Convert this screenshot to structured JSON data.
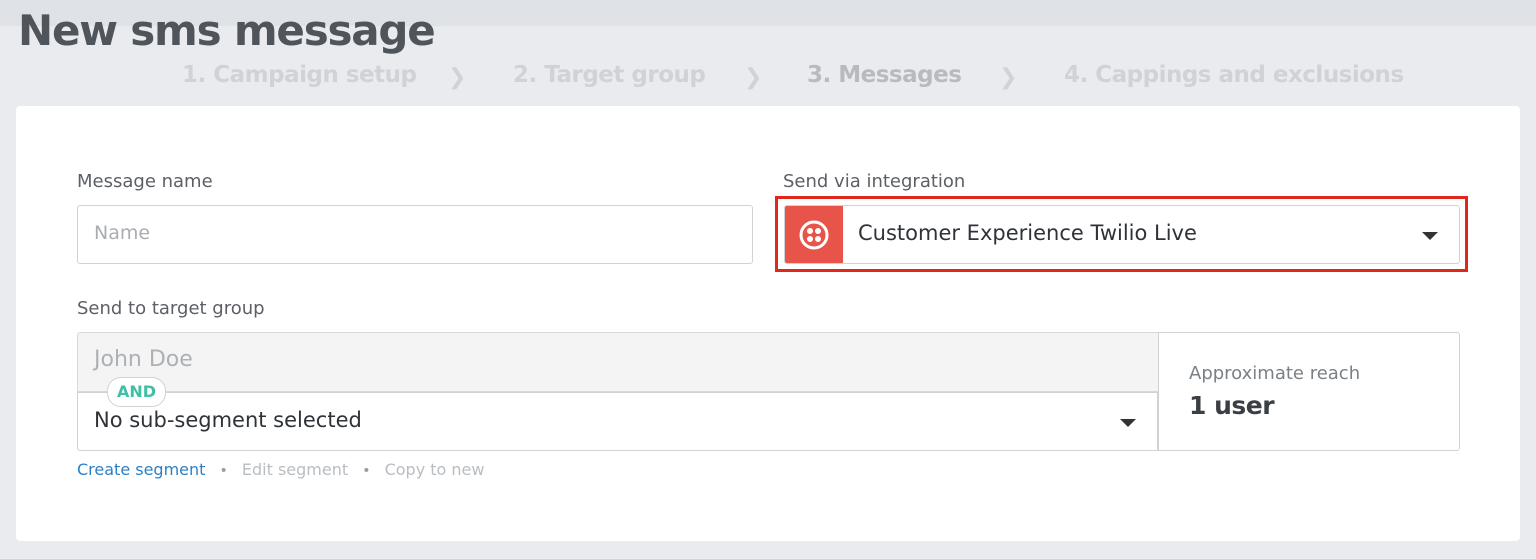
{
  "page": {
    "title": "New sms message"
  },
  "steps": [
    {
      "label": "1. Campaign setup",
      "active": false
    },
    {
      "label": "2. Target group",
      "active": false
    },
    {
      "label": "3. Messages",
      "active": true
    },
    {
      "label": "4. Cappings and exclusions",
      "active": false
    }
  ],
  "form": {
    "message_name": {
      "label": "Message name",
      "placeholder": "Name",
      "value": ""
    },
    "integration": {
      "label": "Send via integration",
      "selected": "Customer Experience Twilio Live",
      "icon": "twilio-icon",
      "icon_color": "#e8534a",
      "highlighted": true,
      "highlight_color": "#e0271c"
    },
    "target_group": {
      "label": "Send to target group",
      "segment_placeholder": "John Doe",
      "operator": "AND",
      "sub_segment": "No sub-segment selected"
    },
    "reach": {
      "label": "Approximate reach",
      "value": "1 user"
    },
    "links": {
      "create": "Create segment",
      "edit": "Edit segment",
      "copy": "Copy to new"
    }
  },
  "colors": {
    "accent_link": "#2d7fc4",
    "and_badge": "#3fbfa4"
  }
}
